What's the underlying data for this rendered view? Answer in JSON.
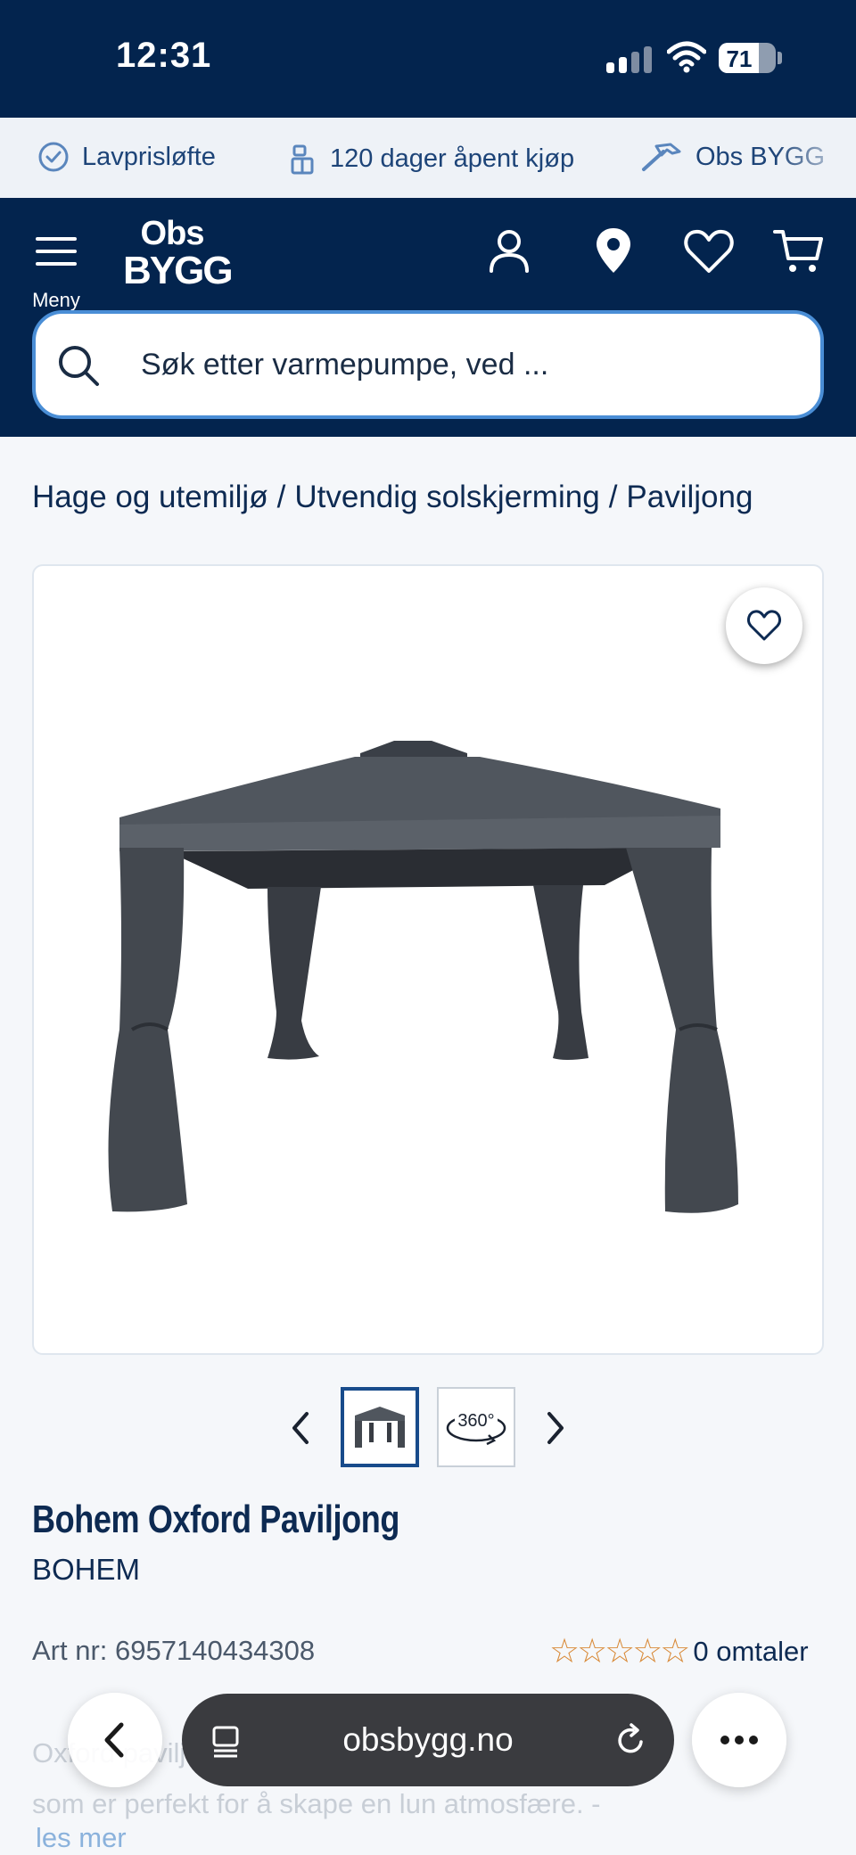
{
  "status_bar": {
    "time": "12:31",
    "battery": "71",
    "battery_level": 0.71
  },
  "usp_bar": {
    "items": [
      {
        "label": "Lavprisløfte",
        "icon": "check-circle-icon"
      },
      {
        "label": "120 dager åpent kjøp",
        "icon": "gift-icon"
      },
      {
        "label": "Obs BYGG",
        "icon": "hammer-icon"
      }
    ]
  },
  "header": {
    "menu_label": "Meny",
    "logo": {
      "line1": "Obs",
      "line2": "BYGG"
    },
    "icons": [
      "user-icon",
      "location-pin-icon",
      "heart-icon",
      "cart-icon"
    ]
  },
  "search": {
    "placeholder": "Søk etter varmepumpe, ved ..."
  },
  "breadcrumb": {
    "items": [
      "Hage og utemiljø",
      "/",
      "Utvendig solskjerming",
      "/",
      "Paviljong"
    ]
  },
  "gallery": {
    "thumb_360_label": "360°"
  },
  "product": {
    "title": "Bohem Oxford Paviljong",
    "brand": "BOHEM",
    "art_nr": "Art nr: 6957140434308",
    "rating_stars": "☆☆☆☆☆",
    "rating": 0,
    "rating_max": 5,
    "reviews": "0 omtaler",
    "description_line1": "Oxford paviljong er en stilfull og robust paviljong",
    "description_line2": "som er perfekt for å skape en lun atmosfære. -",
    "read_more": "les mer"
  },
  "browser": {
    "url": "obsbygg.no"
  },
  "colors": {
    "navy": "#03244e",
    "accent_blue": "#4a8ed6",
    "star": "#d98b3a",
    "text": "#0d2a52"
  }
}
